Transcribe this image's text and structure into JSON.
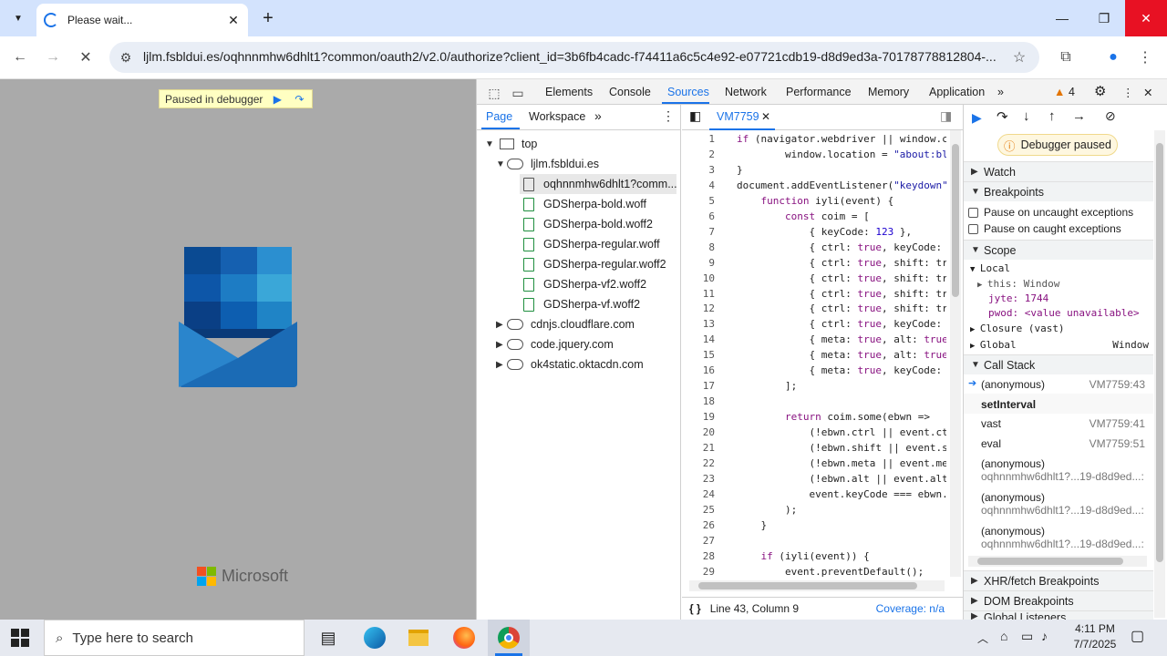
{
  "browser": {
    "tab_title": "Please wait...",
    "url": "ljlm.fsbldui.es/oqhnnmhw6dhlt1?common/oauth2/v2.0/authorize?client_id=3b6fb4cadc-f74411a6c5c4e92-e07721cdb19-d8d9ed3a-70178778812804-..."
  },
  "page": {
    "paused_label": "Paused in debugger",
    "brand": "Microsoft"
  },
  "devtools": {
    "tabs": [
      "Elements",
      "Console",
      "Sources",
      "Network",
      "Performance",
      "Memory",
      "Application"
    ],
    "active_tab": "Sources",
    "warnings": "4",
    "nav_tabs": [
      "Page",
      "Workspace"
    ],
    "tree": {
      "top": "top",
      "domain": "ljlm.fsbldui.es",
      "files": [
        "oqhnnmhw6dhlt1?comm...",
        "GDSherpa-bold.woff",
        "GDSherpa-bold.woff2",
        "GDSherpa-regular.woff",
        "GDSherpa-regular.woff2",
        "GDSherpa-vf2.woff2",
        "GDSherpa-vf.woff2"
      ],
      "other_domains": [
        "cdnjs.cloudflare.com",
        "code.jquery.com",
        "ok4static.oktacdn.com"
      ]
    },
    "editor_tab": "VM7759",
    "line_numbers": [
      "1",
      "2",
      "3",
      "4",
      "5",
      "6",
      "7",
      "8",
      "9",
      "10",
      "11",
      "12",
      "13",
      "14",
      "15",
      "16",
      "17",
      "18",
      "19",
      "20",
      "21",
      "22",
      "23",
      "24",
      "25",
      "26",
      "27",
      "28",
      "29"
    ],
    "code": [
      "if (navigator.webdriver || window.c",
      "        window.location = \"about:bl",
      "}",
      "document.addEventListener(\"keydown\"",
      "    function iyli(event) {",
      "        const coim = [",
      "            { keyCode: 123 },",
      "            { ctrl: true, keyCode:",
      "            { ctrl: true, shift: tr",
      "            { ctrl: true, shift: tr",
      "            { ctrl: true, shift: tr",
      "            { ctrl: true, shift: tr",
      "            { ctrl: true, keyCode:",
      "            { meta: true, alt: true",
      "            { meta: true, alt: true",
      "            { meta: true, keyCode:",
      "        ];",
      "",
      "        return coim.some(ebwn =>",
      "            (!ebwn.ctrl || event.ct",
      "            (!ebwn.shift || event.s",
      "            (!ebwn.meta || event.me",
      "            (!ebwn.alt || event.alt",
      "            event.keyCode === ebwn.",
      "        );",
      "    }",
      "",
      "    if (iyli(event)) {",
      "        event.preventDefault();"
    ],
    "status_position": "Line 43, Column 9",
    "coverage": "Coverage: n/a",
    "debugger_paused": "Debugger paused",
    "sections": {
      "watch": "Watch",
      "breakpoints": "Breakpoints",
      "pause_uncaught": "Pause on uncaught exceptions",
      "pause_caught": "Pause on caught exceptions",
      "scope": "Scope",
      "local": "Local",
      "this_label": "this: Window",
      "jyte": "jyte: 1744",
      "pwod": "pwod: <value unavailable>",
      "closure": "Closure (vast)",
      "global": "Global",
      "global_val": "Window",
      "call_stack": "Call Stack",
      "xhr": "XHR/fetch Breakpoints",
      "dom": "DOM Breakpoints",
      "global_listeners": "Global Listeners"
    },
    "call_stack": [
      {
        "name": "(anonymous)",
        "loc": "VM7759:43"
      },
      {
        "name": "setInterval",
        "loc": ""
      },
      {
        "name": "vast",
        "loc": "VM7759:41"
      },
      {
        "name": "eval",
        "loc": "VM7759:51"
      },
      {
        "name": "(anonymous)",
        "loc": "oqhnnmhw6dhlt1?...19-d8d9ed...:"
      },
      {
        "name": "(anonymous)",
        "loc": "oqhnnmhw6dhlt1?...19-d8d9ed...:"
      },
      {
        "name": "(anonymous)",
        "loc": "oqhnnmhw6dhlt1?...19-d8d9ed...:"
      }
    ]
  },
  "taskbar": {
    "search_placeholder": "Type here to search",
    "time": "4:11 PM",
    "date": "7/7/2025"
  }
}
